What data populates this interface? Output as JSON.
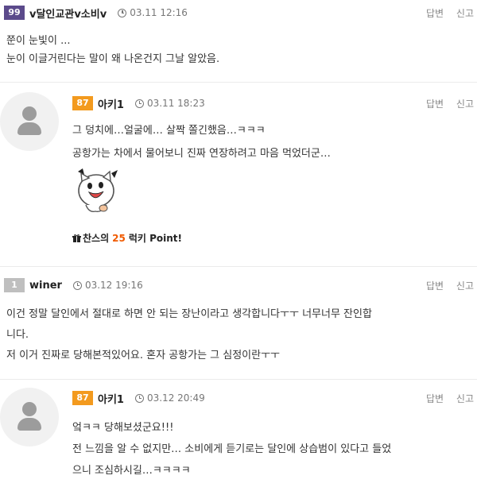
{
  "comments": [
    {
      "level": "99",
      "nickname": "v달인교관v소비v",
      "time": "03.11 12:16",
      "lines": [
        "쭌이 눈빛이 ...",
        "눈이 이글거린다는 말이 왜 나온건지 그날 알았음."
      ]
    },
    {
      "level": "87",
      "nickname": "아키1",
      "time": "03.11 18:23",
      "lines": [
        "그 덩치에…얼굴에… 살짝 쫄긴했음…ㅋㅋㅋ",
        "공항가는 차에서 물어보니 진짜 연장하려고 마음 먹었더군…"
      ],
      "lucky": {
        "prefix": "찬스의",
        "points": "25",
        "suffix": "럭키 Point!"
      }
    },
    {
      "level": "1",
      "nickname": "winer",
      "time": "03.12 19:16",
      "lines": [
        "이건 정말 달인에서 절대로 하면 안 되는 장난이라고 생각합니다ㅜㅜ 너무너무 잔인합",
        "니다.",
        "저 이거 진짜로 당해본적있어요. 혼자 공항가는 그 심정이란ㅜㅜ"
      ]
    },
    {
      "level": "87",
      "nickname": "아키1",
      "time": "03.12 20:49",
      "lines": [
        "엌ㅋㅋ 당해보셨군요!!!",
        "전 느낌을 알 수 없지만… 소비에게 듣기로는 달인에 상습범이 있다고 들었",
        "으니 조심하시길…ㅋㅋㅋㅋ"
      ]
    }
  ],
  "actions": {
    "reply": "답변",
    "report": "신고"
  },
  "colors": {
    "badge_99": "#5b4a8b",
    "badge_87": "#f39a1e",
    "badge_1": "#bfbfbf",
    "points": "#f05a00"
  },
  "icons": {
    "time": "clock-icon",
    "gift": "gift-icon",
    "avatar": "default-avatar-icon",
    "sticker": "cat-sticker"
  }
}
